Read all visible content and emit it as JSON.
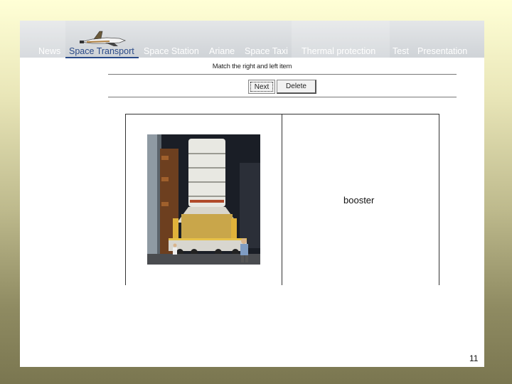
{
  "nav": {
    "items": [
      {
        "label": "News"
      },
      {
        "label": "Space Transport",
        "active": true
      },
      {
        "label": "Space Station"
      },
      {
        "label": "Ariane"
      },
      {
        "label": "Space Taxi"
      },
      {
        "label": "Thermal protection"
      },
      {
        "label": "Test"
      },
      {
        "label": "Presentation"
      }
    ],
    "active_color": "#2a4a88"
  },
  "exercise": {
    "instruction": "Match the right and left item",
    "next_label": "Next",
    "delete_label": "Delete",
    "right_item_text": "booster"
  },
  "slide": {
    "page_number": "11"
  },
  "icons": [
    "space-shuttle-icon"
  ]
}
